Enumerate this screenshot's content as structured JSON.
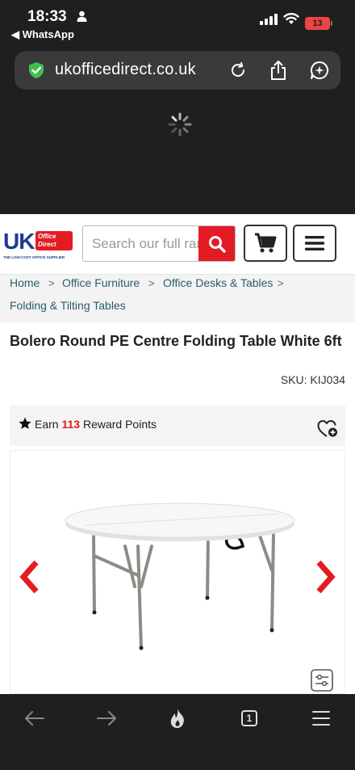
{
  "status_bar": {
    "time": "18:33",
    "back_app": "◀ WhatsApp",
    "battery": "13"
  },
  "browser": {
    "url": "ukofficedirect.co.uk",
    "tab_count": "1"
  },
  "site": {
    "logo_main": "UK",
    "logo_box": "Office Direct",
    "logo_tagline": "THE LOW-COST OFFICE SUPPLIER",
    "search_placeholder": "Search our full range",
    "brand_color": "#e31b23"
  },
  "breadcrumb": {
    "items": [
      "Home",
      "Office Furniture",
      "Office Desks & Tables",
      "Folding & Tilting Tables"
    ],
    "separator": ">"
  },
  "product": {
    "title": "Bolero Round PE Centre Folding Table White 6ft",
    "sku": "SKU: KIJ034",
    "rewards_prefix": "Earn",
    "rewards_points": "113",
    "rewards_suffix": "Reward Points"
  },
  "icons": {
    "status": [
      "person-icon",
      "signal-icon",
      "wifi-icon",
      "battery-icon"
    ],
    "urlbar": [
      "shield-check-icon",
      "reload-icon",
      "share-icon",
      "assistant-icon"
    ],
    "toolbar": [
      "back-arrow-icon",
      "forward-arrow-icon",
      "flame-icon",
      "tabs-icon",
      "menu-icon"
    ]
  }
}
